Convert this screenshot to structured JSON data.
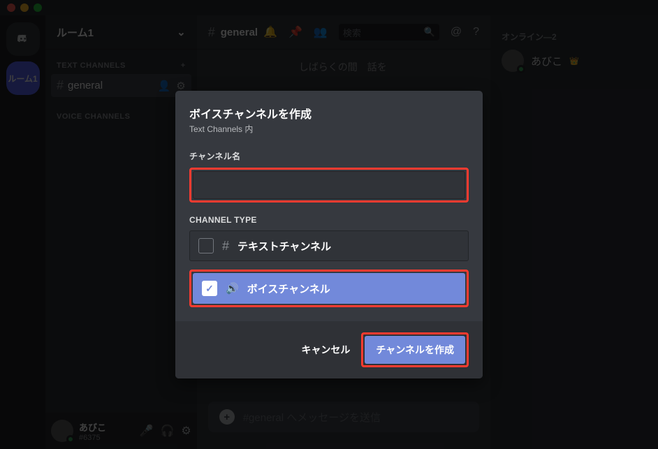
{
  "server": {
    "name": "ルーム1"
  },
  "guild_label": "ルーム1",
  "categories": {
    "text": {
      "label": "TEXT CHANNELS"
    },
    "voice": {
      "label": "VOICE CHANNELS"
    }
  },
  "channels": {
    "general": "general"
  },
  "header": {
    "channel": "general",
    "search_placeholder": "検索"
  },
  "members": {
    "heading": "オンライン—2",
    "list": [
      {
        "name": "あびこ"
      }
    ]
  },
  "user_panel": {
    "name": "あびこ",
    "tag": "#6375"
  },
  "chat": {
    "input_placeholder": "#general へメッセージを送信",
    "welcome": "しばらくの間　話を"
  },
  "modal": {
    "title": "ボイスチャンネルを作成",
    "subtitle": "Text Channels 内",
    "name_label": "チャンネル名",
    "name_value": "",
    "type_label": "CHANNEL TYPE",
    "type_text": "テキストチャンネル",
    "type_voice": "ボイスチャンネル",
    "cancel": "キャンセル",
    "submit": "チャンネルを作成"
  }
}
